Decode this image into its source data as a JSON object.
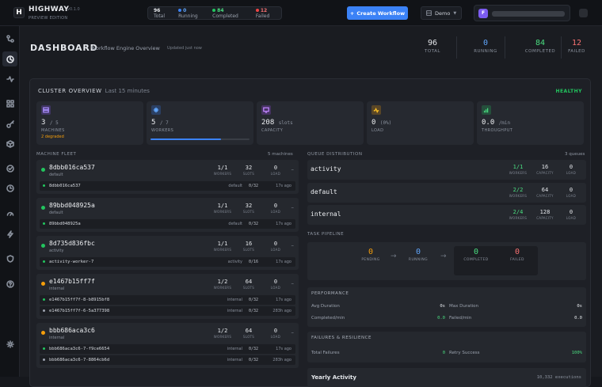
{
  "app": {
    "logo_letter": "H",
    "name": "HIGHWAY",
    "version": "v0.1.0",
    "edition": "PREVIEW EDITION"
  },
  "topbar": {
    "total": "96",
    "total_label": "Total",
    "running": "0",
    "running_label": "Running",
    "completed": "84",
    "completed_label": "Completed",
    "failed": "12",
    "failed_label": "Failed",
    "create_label": "Create Workflow",
    "env_label": "Demo",
    "user_initial": "F"
  },
  "sidebar_icons": [
    "connections-icon",
    "dashboard-icon",
    "activity-icon",
    "grid-icon",
    "key-icon",
    "package-icon",
    "check-circle-icon",
    "clock-icon",
    "gauge-icon",
    "lightning-icon",
    "shield-icon",
    "help-icon",
    "settings-icon"
  ],
  "header": {
    "title": "DASHBOARD",
    "subtitle": "Workflow Engine Overview",
    "updated": "Updated just now"
  },
  "kpis": [
    {
      "value": "96",
      "label": "TOTAL",
      "color": "#e5e7eb"
    },
    {
      "value": "0",
      "label": "RUNNING",
      "color": "#60a5fa"
    },
    {
      "value": "84",
      "label": "COMPLETED",
      "color": "#4ade80"
    },
    {
      "value": "12",
      "label": "FAILED",
      "color": "#f87171"
    }
  ],
  "cluster": {
    "title": "CLUSTER OVERVIEW",
    "window": "Last 15 minutes",
    "status": "HEALTHY",
    "metrics": [
      {
        "big": "3",
        "suffix": "/ 5",
        "label": "MACHINES",
        "sub": "2 degraded",
        "icon": "server-icon",
        "color": "#8b5cf6"
      },
      {
        "big": "5",
        "suffix": "/ 7",
        "label": "WORKERS",
        "sub": "",
        "icon": "workers-icon",
        "color": "#3b82f6",
        "progress": 0.71
      },
      {
        "big": "208",
        "suffix": "slots",
        "label": "CAPACITY",
        "sub": "",
        "icon": "monitor-icon",
        "color": "#a855f7"
      },
      {
        "big": "0",
        "suffix": "(0%)",
        "label": "LOAD",
        "sub": "",
        "icon": "load-icon",
        "color": "#f59e0b"
      },
      {
        "big": "0.0",
        "suffix": "/min",
        "label": "THROUGHPUT",
        "sub": "",
        "icon": "chart-icon",
        "color": "#22c55e"
      }
    ]
  },
  "fleet": {
    "title": "MACHINE FLEET",
    "count": "5 machines",
    "col_workers": "WORKERS",
    "col_slots": "SLOTS",
    "col_load": "LOAD",
    "machines": [
      {
        "name": "8dbb016ca537",
        "tag": "default",
        "status": "#22c55e",
        "workers": "1/1",
        "slots": "32",
        "load": "0",
        "rows": [
          {
            "name": "8dbb016ca537",
            "queue": "default",
            "slots": "0/32",
            "time": "17s ago",
            "dot": "#22c55e"
          }
        ]
      },
      {
        "name": "89bbd048925a",
        "tag": "default",
        "status": "#22c55e",
        "workers": "1/1",
        "slots": "32",
        "load": "0",
        "rows": [
          {
            "name": "89bbd048925a",
            "queue": "default",
            "slots": "0/32",
            "time": "17s ago",
            "dot": "#22c55e"
          }
        ]
      },
      {
        "name": "8d735d836fbc",
        "tag": "activity",
        "status": "#22c55e",
        "workers": "1/1",
        "slots": "16",
        "load": "0",
        "rows": [
          {
            "name": "activity-worker-7",
            "queue": "activity",
            "slots": "0/16",
            "time": "17s ago",
            "dot": "#22c55e"
          }
        ]
      },
      {
        "name": "e1467b15ff7f",
        "tag": "internal",
        "status": "#f59e0b",
        "workers": "1/2",
        "slots": "64",
        "load": "0",
        "rows": [
          {
            "name": "e1467b15ff7f-8-b8915bf8",
            "queue": "internal",
            "slots": "0/32",
            "time": "17s ago",
            "dot": "#22c55e"
          },
          {
            "name": "e1467b15ff7f-6-5a377398",
            "queue": "internal",
            "slots": "0/32",
            "time": "283h ago",
            "dot": "#9ca3af"
          }
        ]
      },
      {
        "name": "bbb686aca3c6",
        "tag": "internal",
        "status": "#f59e0b",
        "workers": "1/2",
        "slots": "64",
        "load": "0",
        "rows": [
          {
            "name": "bbb686aca3c6-7-f9ce6654",
            "queue": "internal",
            "slots": "0/32",
            "time": "17s ago",
            "dot": "#22c55e"
          },
          {
            "name": "bbb686aca3c6-7-8864cb6d",
            "queue": "internal",
            "slots": "0/32",
            "time": "283h ago",
            "dot": "#9ca3af"
          }
        ]
      }
    ]
  },
  "queues": {
    "title": "QUEUE DISTRIBUTION",
    "count": "3 queues",
    "col_workers": "WORKERS",
    "col_capacity": "CAPACITY",
    "col_load": "LOAD",
    "items": [
      {
        "name": "activity",
        "workers": "1/1",
        "capacity": "16",
        "load": "0"
      },
      {
        "name": "default",
        "workers": "2/2",
        "capacity": "64",
        "load": "0"
      },
      {
        "name": "internal",
        "workers": "2/4",
        "capacity": "128",
        "load": "0"
      }
    ]
  },
  "pipeline": {
    "title": "TASK PIPELINE",
    "pending": "0",
    "pending_label": "PENDING",
    "running": "0",
    "running_label": "RUNNING",
    "completed": "0",
    "completed_label": "COMPLETED",
    "failed": "0",
    "failed_label": "FAILED"
  },
  "performance": {
    "title": "PERFORMANCE",
    "avg_duration_label": "Avg Duration",
    "avg_duration": "0s",
    "max_duration_label": "Max Duration",
    "max_duration": "0s",
    "completed_min_label": "Completed/min",
    "completed_min": "0.0",
    "failed_min_label": "Failed/min",
    "failed_min": "0.0"
  },
  "failures": {
    "title": "FAILURES & RESILIENCE",
    "total_label": "Total Failures",
    "total": "0",
    "retry_label": "Retry Success",
    "retry": "100%"
  },
  "yearly": {
    "title": "Yearly Activity",
    "count": "10,332 executions"
  }
}
